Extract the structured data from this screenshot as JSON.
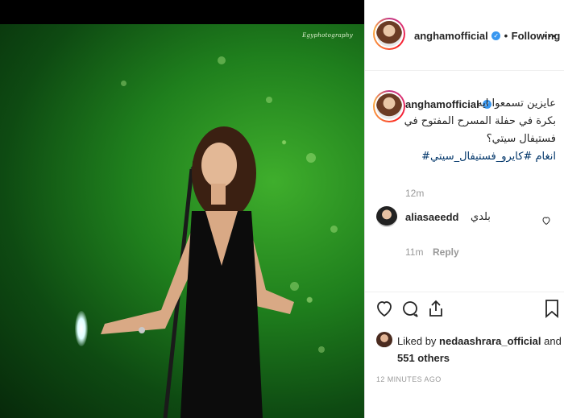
{
  "post": {
    "username": "anghamofficial",
    "follow_separator": "•",
    "follow_status": "Following",
    "more_label": "...",
    "watermark": "Egyphotography"
  },
  "caption": {
    "username": "anghamofficial",
    "lines": [
      "عايزين تسمعوا ايه",
      "بكرة في حفلة المسرح المفتوح في",
      "فستيفال سيتي؟",
      "انغام #كايرو_فستيفال_سيتي#"
    ],
    "time": "12m"
  },
  "comment": {
    "username": "aliasaeedd",
    "text": "بلدي",
    "time": "11m",
    "reply_label": "Reply"
  },
  "likes": {
    "prefix": "Liked by",
    "liker": "nedaashrara_official",
    "and": "and",
    "others": "551 others"
  },
  "posted_ago": "12 MINUTES AGO",
  "icons": {
    "verified": "verified-badge-icon",
    "like": "heart-icon",
    "comment": "comment-icon",
    "share": "share-icon",
    "save": "bookmark-icon"
  },
  "colors": {
    "verified": "#3897f0",
    "link": "#003569",
    "muted": "#999999"
  }
}
